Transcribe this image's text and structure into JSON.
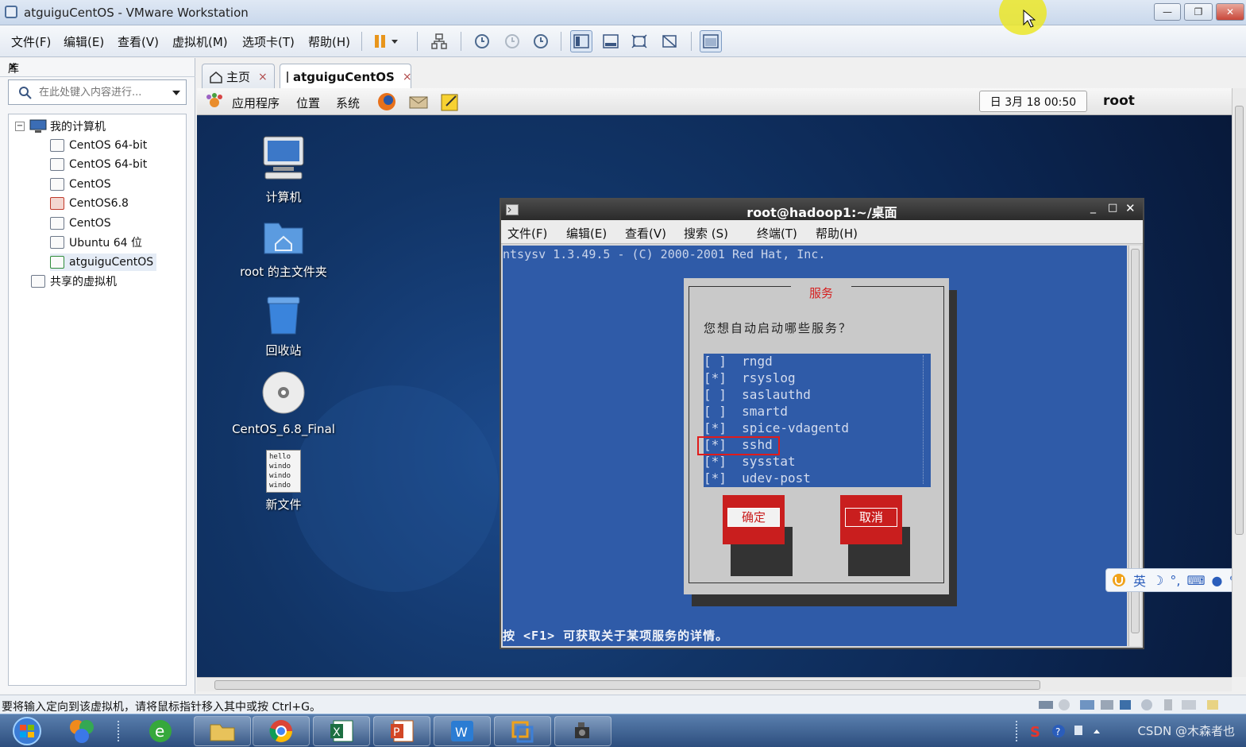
{
  "window": {
    "title": "atguiguCentOS - VMware Workstation",
    "btn_min": "—",
    "btn_max": "❐",
    "btn_close": "✕"
  },
  "menu": {
    "items": [
      "文件(F)",
      "编辑(E)",
      "查看(V)",
      "虚拟机(M)",
      "选项卡(T)",
      "帮助(H)"
    ]
  },
  "library": {
    "title": "库",
    "close": "✕",
    "search_placeholder": "在此处键入内容进行...",
    "tree": {
      "root": "我的计算机",
      "items": [
        "CentOS 64-bit",
        "CentOS 64-bit",
        "CentOS",
        "CentOS6.8",
        "CentOS",
        "Ubuntu 64 位",
        "atguiguCentOS"
      ],
      "shared": "共享的虚拟机"
    }
  },
  "tabs": [
    {
      "label": "主页",
      "close": "×"
    },
    {
      "label": "atguiguCentOS",
      "close": "×"
    }
  ],
  "gnome_panel": {
    "apps": "应用程序",
    "places": "位置",
    "system": "系统",
    "clock": "日 3月 18 00:50",
    "user": "root"
  },
  "desktop": {
    "icons": [
      "计算机",
      "root 的主文件夹",
      "回收站",
      "CentOS_6.8_Final",
      "新文件"
    ],
    "note_lines": [
      "hello",
      "windo",
      "windo",
      "windo"
    ]
  },
  "terminal": {
    "title": "root@hadoop1:~/桌面",
    "menu": [
      "文件(F)",
      "编辑(E)",
      "查看(V)",
      "搜索 (S)",
      "终端(T)",
      "帮助(H)"
    ],
    "header_line": "ntsysv 1.3.49.5 - (C) 2000-2001 Red Hat, Inc.",
    "footer_line": "按 <F1> 可获取关于某项服务的详情。",
    "dialog": {
      "title": "服务",
      "prompt": "您想自动启动哪些服务？",
      "services": [
        {
          "mark": "[ ]",
          "name": "rngd"
        },
        {
          "mark": "[*]",
          "name": "rsyslog"
        },
        {
          "mark": "[ ]",
          "name": "saslauthd"
        },
        {
          "mark": "[ ]",
          "name": "smartd"
        },
        {
          "mark": "[*]",
          "name": "spice-vdagentd"
        },
        {
          "mark": "[*]",
          "name": "sshd"
        },
        {
          "mark": "[*]",
          "name": "sysstat"
        },
        {
          "mark": "[*]",
          "name": "udev-post"
        }
      ],
      "ok": "确定",
      "cancel": "取消"
    }
  },
  "ime": {
    "label": "英"
  },
  "statusbar": {
    "message": "要将输入定向到该虚拟机，请将鼠标指针移入其中或按 Ctrl+G。"
  },
  "taskbar": {
    "watermark": "CSDN @木森者也"
  },
  "colors": {
    "terminal_bg": "#2f5ba8",
    "dialog_bg": "#c9c9c9",
    "button_red": "#c91e1e",
    "highlight_red": "#e01b1b"
  }
}
